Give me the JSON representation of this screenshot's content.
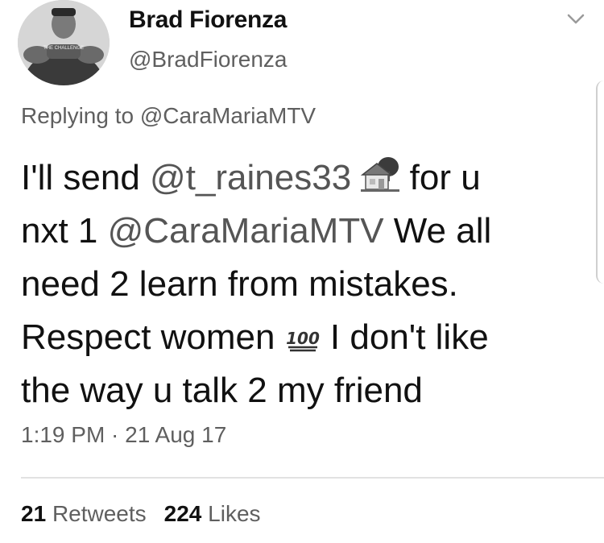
{
  "author": {
    "display_name": "Brad Fiorenza",
    "handle": "@BradFiorenza",
    "avatar_shirt_text": "THE CHALLENGE"
  },
  "reply": {
    "prefix": "Replying to",
    "mention": "@CaraMariaMTV"
  },
  "tweet": {
    "l1_a": "I'll send ",
    "l1_mention": "@t_raines33",
    "l1_emoji": "house-with-garden-emoji",
    "l1_b": " for u",
    "l2_a": "nxt 1 ",
    "l2_mention": "@CaraMariaMTV",
    "l2_b": " We all",
    "l3": "need 2 learn from mistakes.",
    "l4_a": "Respect women ",
    "l4_emoji": "hundred-points-emoji",
    "l4_emoji_text": "100",
    "l4_b": " I don't like",
    "l5": "the way u talk 2 my friend"
  },
  "timestamp": "1:19 PM · 21 Aug 17",
  "stats": {
    "retweets_count": "21",
    "retweets_label": "Retweets",
    "likes_count": "224",
    "likes_label": "Likes"
  },
  "colors": {
    "text": "#111111",
    "secondary": "#5f5f5f",
    "divider": "#e2e2e2"
  }
}
